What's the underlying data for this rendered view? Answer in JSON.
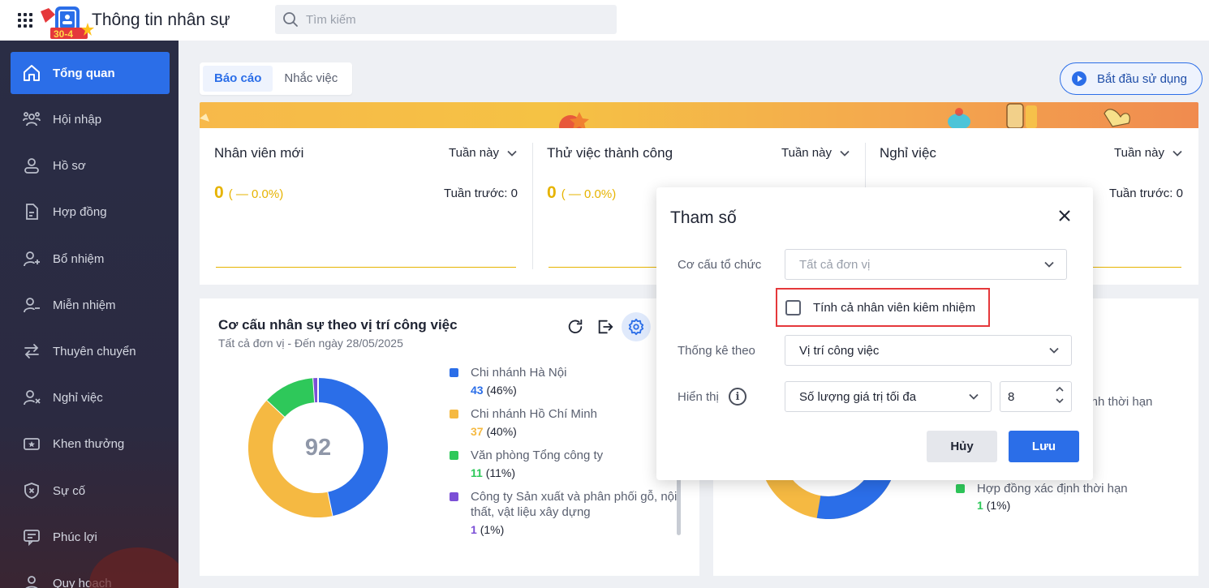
{
  "app": {
    "title": "Thông tin nhân sự",
    "logo_badge": "30-4"
  },
  "search": {
    "placeholder": "Tìm kiếm"
  },
  "sidebar": {
    "items": [
      {
        "label": "Tổng quan",
        "icon": "home-icon",
        "active": true
      },
      {
        "label": "Hội nhập",
        "icon": "users-group-icon"
      },
      {
        "label": "Hồ sơ",
        "icon": "user-icon"
      },
      {
        "label": "Hợp đồng",
        "icon": "document-icon"
      },
      {
        "label": "Bổ nhiệm",
        "icon": "user-plus-icon"
      },
      {
        "label": "Miễn nhiệm",
        "icon": "user-minus-icon"
      },
      {
        "label": "Thuyên chuyển",
        "icon": "transfer-icon"
      },
      {
        "label": "Nghỉ việc",
        "icon": "user-x-icon"
      },
      {
        "label": "Khen thưởng",
        "icon": "award-icon"
      },
      {
        "label": "Sự cố",
        "icon": "shield-x-icon"
      },
      {
        "label": "Phúc lợi",
        "icon": "benefit-icon"
      },
      {
        "label": "Quy hoạch",
        "icon": "planning-icon"
      }
    ]
  },
  "tabs": [
    {
      "label": "Báo cáo",
      "active": true
    },
    {
      "label": "Nhắc việc",
      "active": false
    }
  ],
  "start_button": {
    "label": "Bắt đầu sử dụng"
  },
  "stats": [
    {
      "title": "Nhân viên mới",
      "period": "Tuần này",
      "value": "0",
      "change": "( — 0.0%)",
      "previous": "Tuần trước: 0"
    },
    {
      "title": "Thử việc thành công",
      "period": "Tuần này",
      "value": "0",
      "change": "( — 0.0%)",
      "previous": "Tuần trước: 0"
    },
    {
      "title": "Nghỉ việc",
      "period": "Tuần này",
      "value": "",
      "change": "",
      "previous": "Tuần trước: 0"
    }
  ],
  "chart1": {
    "title": "Cơ cấu nhân sự theo vị trí công việc",
    "subtitle": "Tất cả đơn vị - Đến ngày 28/05/2025",
    "center_value": "92",
    "legend": [
      {
        "name": "Chi nhánh Hà Nội",
        "value": "43",
        "percent": "(46%)",
        "color": "#2b6ee8"
      },
      {
        "name": "Chi nhánh Hồ Chí Minh",
        "value": "37",
        "percent": "(40%)",
        "color": "#f5b942"
      },
      {
        "name": "Văn phòng Tổng công ty",
        "value": "11",
        "percent": "(11%)",
        "color": "#2ec85a"
      },
      {
        "name": "Công ty Sản xuất và phân phối gỗ, nội thất, vật liệu xây dựng",
        "value": "1",
        "percent": "(1%)",
        "color": "#7b4fd6"
      }
    ]
  },
  "chart2": {
    "legend_partial": [
      {
        "name": "định thời hạn"
      },
      {
        "name": "Hợp đồng xác định thời hạn",
        "value": "1",
        "percent": "(1%)",
        "color": "#2ec85a"
      }
    ]
  },
  "modal": {
    "title": "Tham số",
    "org_label": "Cơ cấu tổ chức",
    "org_value": "Tất cả đơn vị",
    "checkbox_label": "Tính cả nhân viên kiêm nhiệm",
    "checkbox_checked": false,
    "stat_by_label": "Thống kê theo",
    "stat_by_value": "Vị trí công việc",
    "display_label": "Hiển thị",
    "display_value": "Số lượng giá trị tối đa",
    "max_value": "8",
    "cancel_label": "Hủy",
    "save_label": "Lưu"
  },
  "colors": {
    "primary": "#2b6ee8",
    "sidebar": "#2a2d45",
    "warning": "#e6b300",
    "highlight": "#e5383b"
  }
}
